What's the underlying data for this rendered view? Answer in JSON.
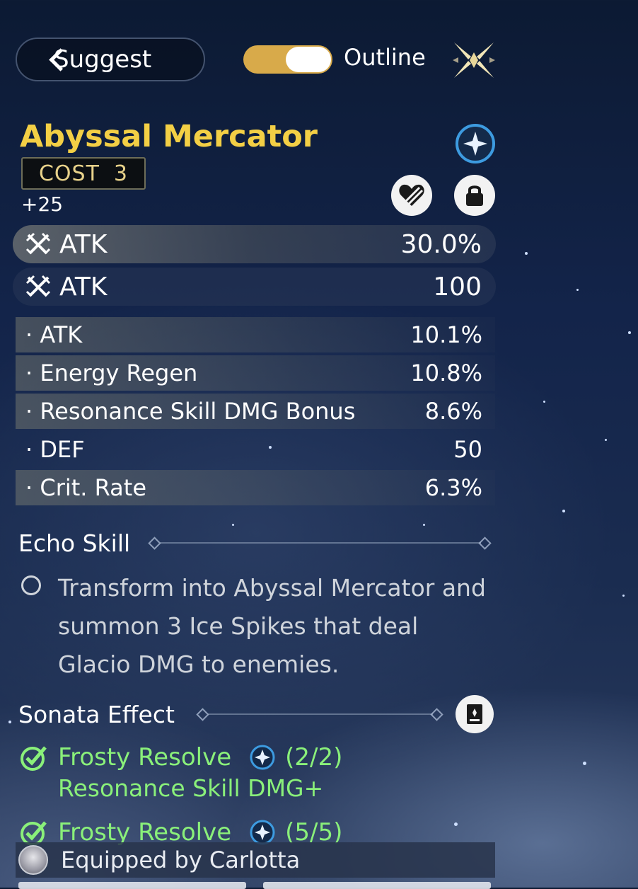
{
  "header": {
    "back_label": "Suggest",
    "toggle_label": "Outline",
    "toggle_on": true
  },
  "echo": {
    "name": "Abyssal Mercator",
    "cost_label": "COST",
    "cost_value": "3",
    "level": "+25"
  },
  "main_stats": [
    {
      "name": "ATK",
      "value": "30.0%"
    },
    {
      "name": "ATK",
      "value": "100"
    }
  ],
  "sub_stats": [
    {
      "name": "ATK",
      "value": "10.1%"
    },
    {
      "name": "Energy Regen",
      "value": "10.8%"
    },
    {
      "name": "Resonance Skill DMG Bonus",
      "value": "8.6%"
    },
    {
      "name": "DEF",
      "value": "50"
    },
    {
      "name": "Crit. Rate",
      "value": "6.3%"
    }
  ],
  "echo_skill": {
    "title": "Echo Skill",
    "description": "Transform into Abyssal Mercator and summon 3 Ice Spikes that deal Glacio DMG to enemies."
  },
  "sonata": {
    "title": "Sonata Effect",
    "sets": [
      {
        "name": "Frosty Resolve",
        "count": "(2/2)",
        "effect": "Resonance Skill DMG+"
      },
      {
        "name": "Frosty Resolve",
        "count": "(5/5)"
      }
    ]
  },
  "equipped": {
    "text": "Equipped by Carlotta"
  },
  "colors": {
    "title_gold": "#f3cf45",
    "toggle_gold": "#d8aa4a",
    "sonata_green": "#8af07a",
    "element_blue": "#3d9be0"
  },
  "icons": [
    "chevron-left-icon",
    "close-icon",
    "glacio-element-icon",
    "heart-icon",
    "lock-icon",
    "attack-icon",
    "circle-bullet-icon",
    "book-icon",
    "check-icon",
    "avatar"
  ]
}
